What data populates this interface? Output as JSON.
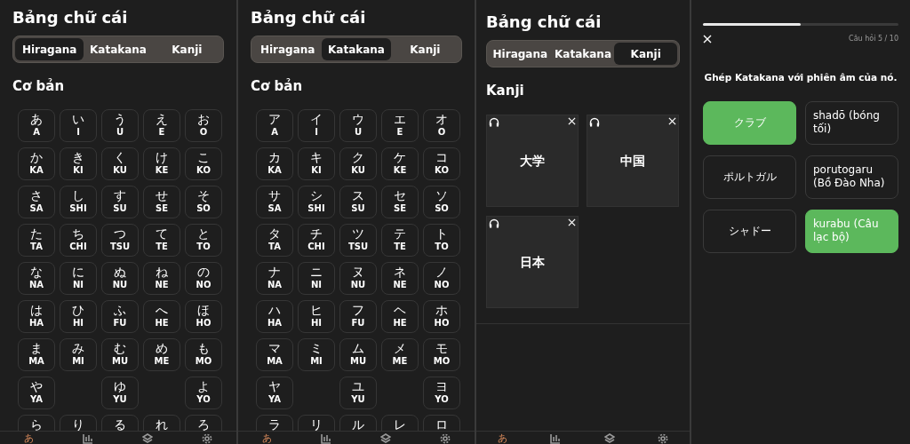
{
  "panels": [
    {
      "kind": "kana",
      "title": "Bảng chữ cái",
      "tabs": [
        {
          "label": "Hiragana",
          "selected": true
        },
        {
          "label": "Katakana",
          "selected": false
        },
        {
          "label": "Kanji",
          "selected": false
        }
      ],
      "section": "Cơ bản",
      "cells": [
        {
          "kind": "kana",
          "kana": "あ",
          "romaji": "A"
        },
        {
          "kind": "kana",
          "kana": "い",
          "romaji": "I"
        },
        {
          "kind": "kana",
          "kana": "う",
          "romaji": "U"
        },
        {
          "kind": "kana",
          "kana": "え",
          "romaji": "E"
        },
        {
          "kind": "kana",
          "kana": "お",
          "romaji": "O"
        },
        {
          "kind": "kana",
          "kana": "か",
          "romaji": "KA"
        },
        {
          "kind": "kana",
          "kana": "き",
          "romaji": "KI"
        },
        {
          "kind": "kana",
          "kana": "く",
          "romaji": "KU"
        },
        {
          "kind": "kana",
          "kana": "け",
          "romaji": "KE"
        },
        {
          "kind": "kana",
          "kana": "こ",
          "romaji": "KO"
        },
        {
          "kind": "kana",
          "kana": "さ",
          "romaji": "SA"
        },
        {
          "kind": "kana",
          "kana": "し",
          "romaji": "SHI"
        },
        {
          "kind": "kana",
          "kana": "す",
          "romaji": "SU"
        },
        {
          "kind": "kana",
          "kana": "せ",
          "romaji": "SE"
        },
        {
          "kind": "kana",
          "kana": "そ",
          "romaji": "SO"
        },
        {
          "kind": "kana",
          "kana": "た",
          "romaji": "TA"
        },
        {
          "kind": "kana",
          "kana": "ち",
          "romaji": "CHI"
        },
        {
          "kind": "kana",
          "kana": "つ",
          "romaji": "TSU"
        },
        {
          "kind": "kana",
          "kana": "て",
          "romaji": "TE"
        },
        {
          "kind": "kana",
          "kana": "と",
          "romaji": "TO"
        },
        {
          "kind": "kana",
          "kana": "な",
          "romaji": "NA"
        },
        {
          "kind": "kana",
          "kana": "に",
          "romaji": "NI"
        },
        {
          "kind": "kana",
          "kana": "ぬ",
          "romaji": "NU"
        },
        {
          "kind": "kana",
          "kana": "ね",
          "romaji": "NE"
        },
        {
          "kind": "kana",
          "kana": "の",
          "romaji": "NO"
        },
        {
          "kind": "kana",
          "kana": "は",
          "romaji": "HA"
        },
        {
          "kind": "kana",
          "kana": "ひ",
          "romaji": "HI"
        },
        {
          "kind": "kana",
          "kana": "ふ",
          "romaji": "FU"
        },
        {
          "kind": "kana",
          "kana": "へ",
          "romaji": "HE"
        },
        {
          "kind": "kana",
          "kana": "ほ",
          "romaji": "HO"
        },
        {
          "kind": "kana",
          "kana": "ま",
          "romaji": "MA"
        },
        {
          "kind": "kana",
          "kana": "み",
          "romaji": "MI"
        },
        {
          "kind": "kana",
          "kana": "む",
          "romaji": "MU"
        },
        {
          "kind": "kana",
          "kana": "め",
          "romaji": "ME"
        },
        {
          "kind": "kana",
          "kana": "も",
          "romaji": "MO"
        },
        {
          "kind": "kana",
          "kana": "や",
          "romaji": "YA"
        },
        {
          "kind": "blank"
        },
        {
          "kind": "kana",
          "kana": "ゆ",
          "romaji": "YU"
        },
        {
          "kind": "blank"
        },
        {
          "kind": "kana",
          "kana": "よ",
          "romaji": "YO"
        },
        {
          "kind": "kana",
          "kana": "ら"
        },
        {
          "kind": "kana",
          "kana": "り"
        },
        {
          "kind": "kana",
          "kana": "る"
        },
        {
          "kind": "kana",
          "kana": "れ"
        },
        {
          "kind": "kana",
          "kana": "ろ"
        }
      ],
      "nav": [
        {
          "kind": "glyph",
          "label": "あ",
          "selected": true
        },
        {
          "kind": "chart",
          "selected": false
        },
        {
          "kind": "layers",
          "selected": false
        },
        {
          "kind": "settings",
          "selected": false
        }
      ]
    },
    {
      "kind": "kana",
      "title": "Bảng chữ cái",
      "tabs": [
        {
          "label": "Hiragana",
          "selected": false
        },
        {
          "label": "Katakana",
          "selected": true
        },
        {
          "label": "Kanji",
          "selected": false
        }
      ],
      "section": "Cơ bản",
      "cells": [
        {
          "kind": "kana",
          "kana": "ア",
          "romaji": "A"
        },
        {
          "kind": "kana",
          "kana": "イ",
          "romaji": "I"
        },
        {
          "kind": "kana",
          "kana": "ウ",
          "romaji": "U"
        },
        {
          "kind": "kana",
          "kana": "エ",
          "romaji": "E"
        },
        {
          "kind": "kana",
          "kana": "オ",
          "romaji": "O"
        },
        {
          "kind": "kana",
          "kana": "カ",
          "romaji": "KA"
        },
        {
          "kind": "kana",
          "kana": "キ",
          "romaji": "KI"
        },
        {
          "kind": "kana",
          "kana": "ク",
          "romaji": "KU"
        },
        {
          "kind": "kana",
          "kana": "ケ",
          "romaji": "KE"
        },
        {
          "kind": "kana",
          "kana": "コ",
          "romaji": "KO"
        },
        {
          "kind": "kana",
          "kana": "サ",
          "romaji": "SA"
        },
        {
          "kind": "kana",
          "kana": "シ",
          "romaji": "SHI"
        },
        {
          "kind": "kana",
          "kana": "ス",
          "romaji": "SU"
        },
        {
          "kind": "kana",
          "kana": "セ",
          "romaji": "SE"
        },
        {
          "kind": "kana",
          "kana": "ソ",
          "romaji": "SO"
        },
        {
          "kind": "kana",
          "kana": "タ",
          "romaji": "TA"
        },
        {
          "kind": "kana",
          "kana": "チ",
          "romaji": "CHI"
        },
        {
          "kind": "kana",
          "kana": "ツ",
          "romaji": "TSU"
        },
        {
          "kind": "kana",
          "kana": "テ",
          "romaji": "TE"
        },
        {
          "kind": "kana",
          "kana": "ト",
          "romaji": "TO"
        },
        {
          "kind": "kana",
          "kana": "ナ",
          "romaji": "NA"
        },
        {
          "kind": "kana",
          "kana": "ニ",
          "romaji": "NI"
        },
        {
          "kind": "kana",
          "kana": "ヌ",
          "romaji": "NU"
        },
        {
          "kind": "kana",
          "kana": "ネ",
          "romaji": "NE"
        },
        {
          "kind": "kana",
          "kana": "ノ",
          "romaji": "NO"
        },
        {
          "kind": "kana",
          "kana": "ハ",
          "romaji": "HA"
        },
        {
          "kind": "kana",
          "kana": "ヒ",
          "romaji": "HI"
        },
        {
          "kind": "kana",
          "kana": "フ",
          "romaji": "FU"
        },
        {
          "kind": "kana",
          "kana": "ヘ",
          "romaji": "HE"
        },
        {
          "kind": "kana",
          "kana": "ホ",
          "romaji": "HO"
        },
        {
          "kind": "kana",
          "kana": "マ",
          "romaji": "MA"
        },
        {
          "kind": "kana",
          "kana": "ミ",
          "romaji": "MI"
        },
        {
          "kind": "kana",
          "kana": "ム",
          "romaji": "MU"
        },
        {
          "kind": "kana",
          "kana": "メ",
          "romaji": "ME"
        },
        {
          "kind": "kana",
          "kana": "モ",
          "romaji": "MO"
        },
        {
          "kind": "kana",
          "kana": "ヤ",
          "romaji": "YA"
        },
        {
          "kind": "blank"
        },
        {
          "kind": "kana",
          "kana": "ユ",
          "romaji": "YU"
        },
        {
          "kind": "blank"
        },
        {
          "kind": "kana",
          "kana": "ヨ",
          "romaji": "YO"
        },
        {
          "kind": "kana",
          "kana": "ラ"
        },
        {
          "kind": "kana",
          "kana": "リ"
        },
        {
          "kind": "kana",
          "kana": "ル"
        },
        {
          "kind": "kana",
          "kana": "レ"
        },
        {
          "kind": "kana",
          "kana": "ロ"
        }
      ],
      "nav": [
        {
          "kind": "glyph",
          "label": "あ",
          "selected": true
        },
        {
          "kind": "chart",
          "selected": false
        },
        {
          "kind": "layers",
          "selected": false
        },
        {
          "kind": "settings",
          "selected": false
        }
      ]
    },
    {
      "kind": "kanji",
      "title": "Bảng chữ cái",
      "tabs": [
        {
          "label": "Hiragana",
          "selected": false
        },
        {
          "label": "Katakana",
          "selected": false
        },
        {
          "label": "Kanji",
          "selected": true
        }
      ],
      "section": "Kanji",
      "cards": [
        {
          "kanji": "大学"
        },
        {
          "kanji": "中国"
        },
        {
          "kanji": "日本"
        }
      ],
      "nav": [
        {
          "kind": "glyph",
          "label": "あ",
          "selected": true
        },
        {
          "kind": "chart",
          "selected": false
        },
        {
          "kind": "layers",
          "selected": false
        },
        {
          "kind": "settings",
          "selected": false
        }
      ]
    },
    {
      "kind": "quiz",
      "progress": {
        "level": 0.5
      },
      "counter": "Câu hỏi 5 / 10",
      "prompt": "Ghép Katakana với phiên âm của nó.",
      "options": [
        {
          "label": "クラブ",
          "matched": true
        },
        {
          "label": "ポルトガル",
          "matched": false
        },
        {
          "label": "シャドー",
          "matched": false
        },
        {
          "label": "shadō (bóng tối)",
          "matched": false
        },
        {
          "label": "porutogaru (Bồ Đào Nha)",
          "matched": false
        },
        {
          "label": "kurabu (Câu lạc bộ)",
          "matched": true
        }
      ]
    }
  ]
}
